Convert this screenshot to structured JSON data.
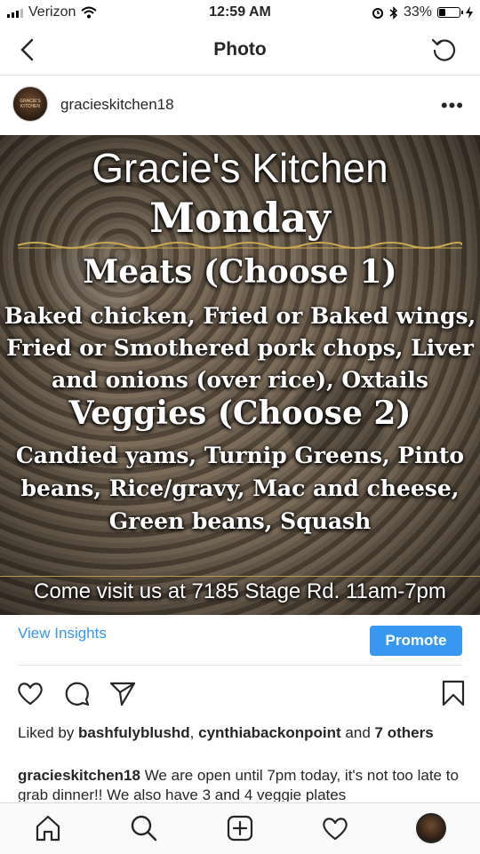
{
  "status_bar": {
    "carrier": "Verizon",
    "time": "12:59 AM",
    "battery": "33%",
    "battery_level": 0.33
  },
  "nav": {
    "title": "Photo"
  },
  "post": {
    "username": "gracieskitchen18",
    "image": {
      "title": "Gracie's Kitchen",
      "day": "Monday",
      "meats_heading": "Meats (Choose 1)",
      "meats_lines": [
        "Baked chicken, Fried or Baked wings,",
        "Fried or Smothered pork chops, Liver",
        "and onions (over rice), Oxtails"
      ],
      "veggies_heading": "Veggies (Choose 2)",
      "veggies_lines": [
        "Candied yams, Turnip Greens, Pinto",
        "beans, Rice/gravy, Mac and cheese,",
        "Green beans, Squash"
      ],
      "footer": "Come visit us at 7185 Stage Rd. 11am-7pm"
    },
    "insights_label": "View Insights",
    "promote_label": "Promote",
    "likes": {
      "prefix": "Liked by ",
      "user1": "bashfulyblushd",
      "sep": ", ",
      "user2": "cynthiabackonpoint",
      "and": " and ",
      "others": "7 others"
    },
    "caption": {
      "username": "gracieskitchen18",
      "text": " We are open until 7pm today, it's not too late to grab dinner!! We also have 3 and 4 veggie plates"
    }
  },
  "icons": {
    "back": "chevron-left-icon",
    "refresh": "refresh-icon",
    "more": "more-icon",
    "like": "heart-icon",
    "comment": "comment-icon",
    "share": "send-icon",
    "save": "bookmark-icon",
    "home": "home-icon",
    "search": "search-icon",
    "add": "add-post-icon",
    "activity": "heart-icon",
    "profile": "profile-avatar"
  },
  "colors": {
    "accent": "#3897f0",
    "text": "#262626",
    "divider": "#dbdbdb"
  }
}
